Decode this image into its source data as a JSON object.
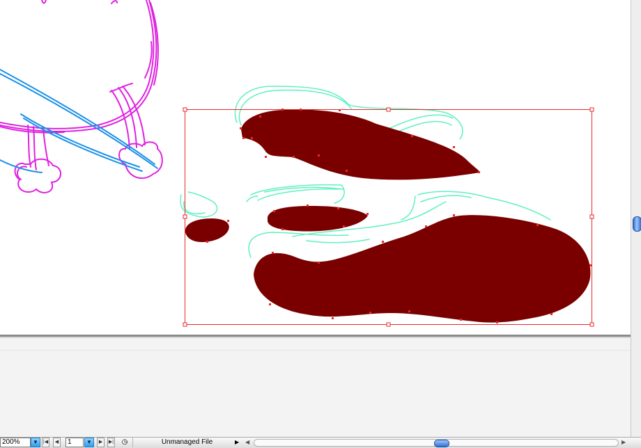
{
  "window": {
    "zoom": "200%",
    "page_number": "1",
    "status_text": "Unmanaged File"
  },
  "controls": {
    "zoom_dropdown_icon": "triangle-down",
    "first_page_icon": "first-page",
    "prev_page_icon": "prev-page",
    "page_dropdown_icon": "triangle-down",
    "next_page_icon": "next-page",
    "last_page_icon": "last-page",
    "status_menu_icon": "triangle-right",
    "scroll_left_icon": "triangle-left",
    "scroll_right_icon": "triangle-right",
    "vertical_scroll_position": 0.5,
    "horizontal_scroll_position": 0.5
  },
  "artwork": {
    "fill_color": "#7a0000",
    "selection_color": "#e8262a",
    "sketch_magenta": "#e020e0",
    "sketch_blue": "#1a8fe8",
    "sketch_cyan": "#5ff0c0"
  }
}
